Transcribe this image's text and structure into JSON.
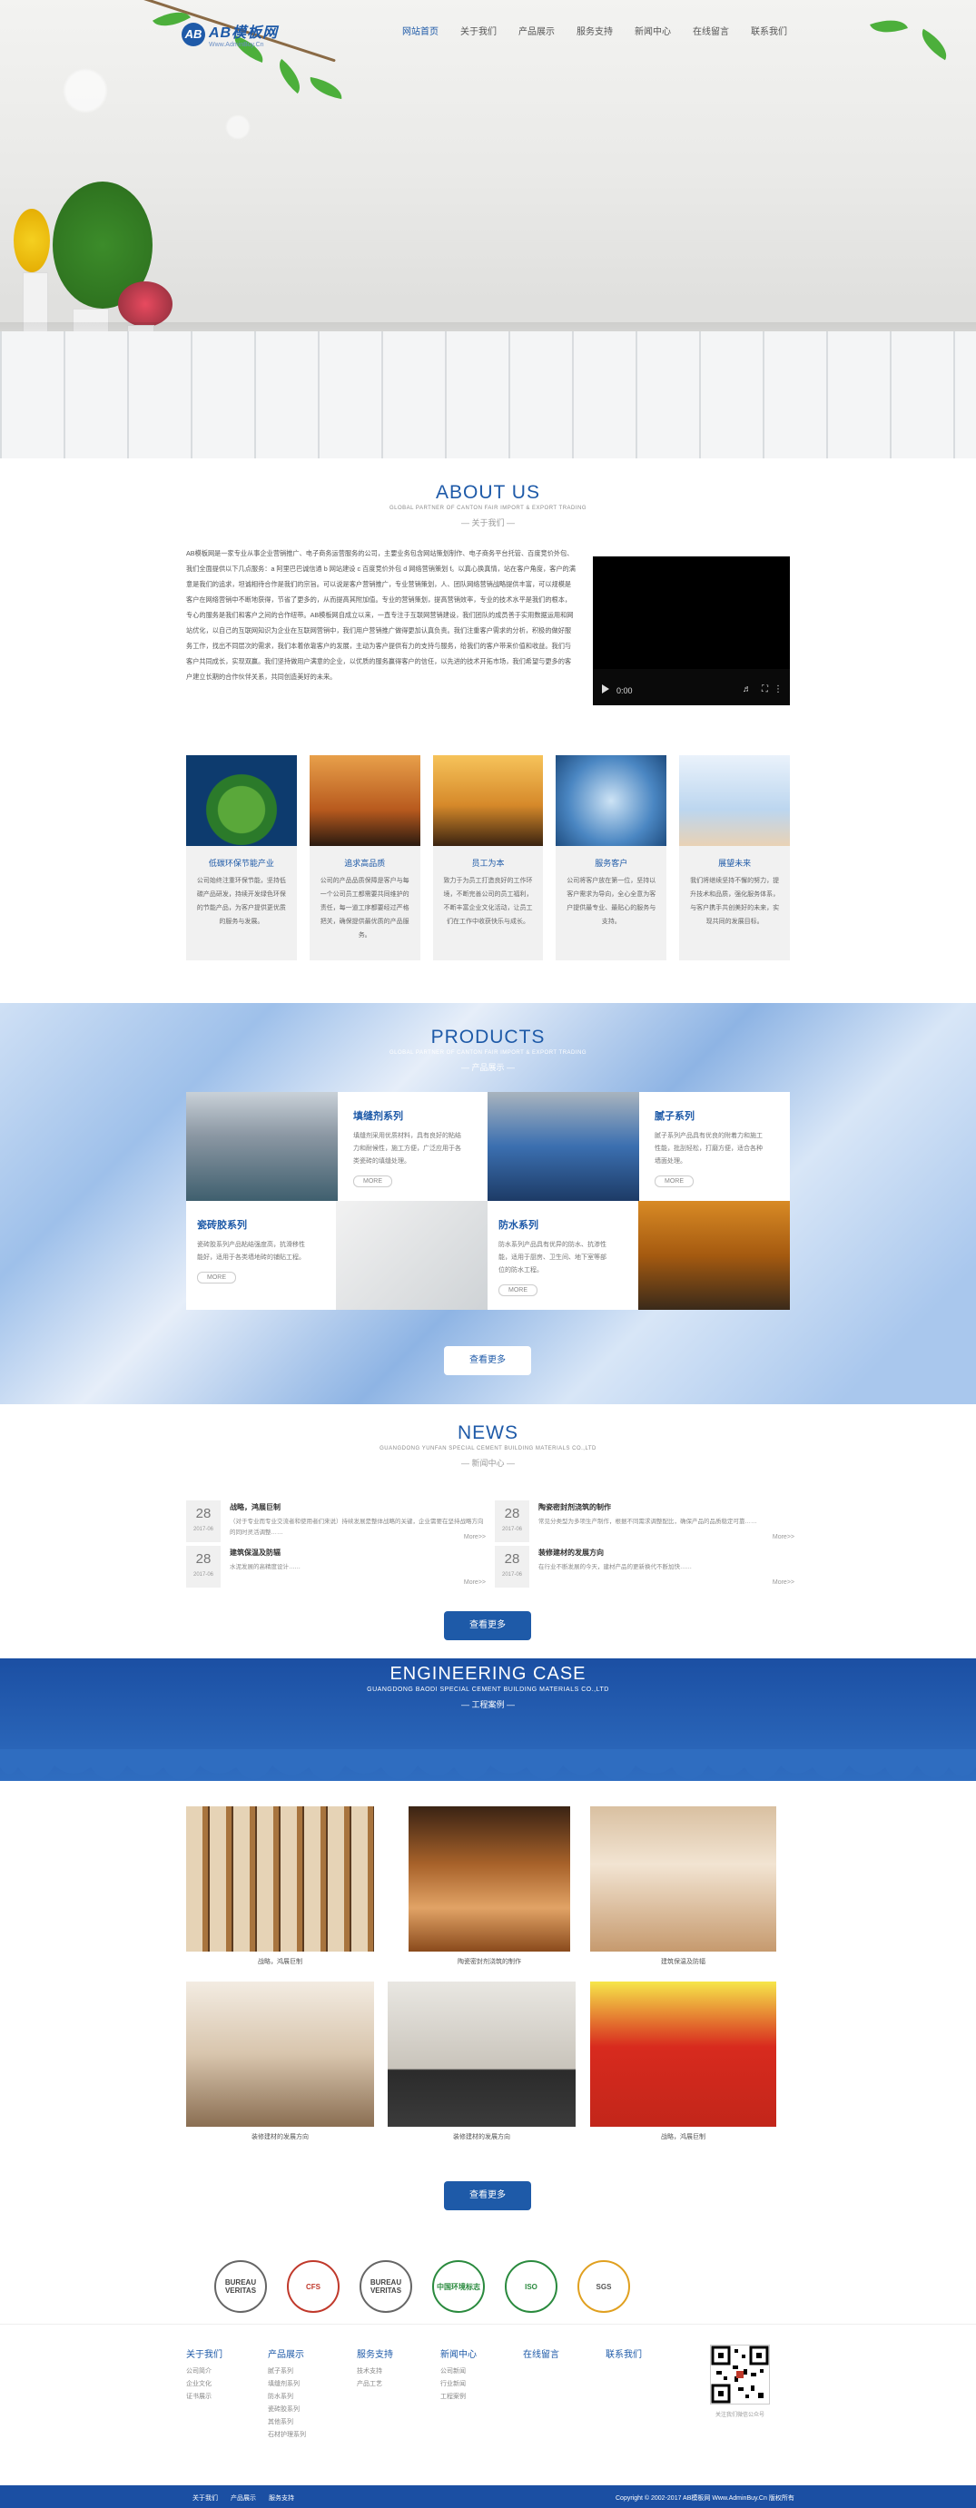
{
  "logo": {
    "mark": "AB",
    "name": "AB模板网",
    "sub": "Www.AdminBuy.Cn"
  },
  "nav": [
    "网站首页",
    "关于我们",
    "产品展示",
    "服务支持",
    "新闻中心",
    "在线留言",
    "联系我们"
  ],
  "about": {
    "title": "ABOUT US",
    "sub": "GLOBAL PARTNER OF CANTON FAIR IMPORT & EXPORT TRADING",
    "cn": "— 关于我们 —",
    "text": "AB模板网是一家专业从事企业营销推广、电子商务运营服务的公司，主要业务包含网站策划制作、电子商务平台托管、百度竞价外包、我们全面提供以下几点服务：a 阿里巴巴诚信通 b 网站建设 c 百度竞价外包 d 网络营销策划 f。以真心换真情，站在客户角度，客户的满意是我们的追求，坦诚相待合作是我们的宗旨。可以说是客户营销推广，专业营销策划，人、团队网络营销战略提供丰富，可以规模是客户在网络营销中不断地获得，节省了更多的，从而提高其附加值。专业的营销策划，提高营销效率，专业的技术水平是我们的根本，专心的服务是我们和客户之间的合作纽带。AB模板网自成立以来，一直专注于互联网营销建设，我们团队的成员善于实用数据运用和网站优化，以自己的互联网知识为企业在互联网营销中，我们用户营销推广做得更加认真负责。我们注重客户需求的分析，积极的做好服务工作，找出不同层次的需求，我们本着依靠客户的发展，主动为客户提供有力的支持与服务，给我们的客户带来价值和收益。我们与客户共同成长，实现双赢。我们坚持做用户满意的企业，以优质的服务赢得客户的信任，以先进的技术开拓市场，我们希望与更多的客户建立长期的合作伙伴关系，共同创造美好的未来。",
    "video_time": "0:00"
  },
  "cards": [
    {
      "title": "低碳环保节能产业",
      "text": "公司始终注重环保节能，坚持低碳产品研发，持续开发绿色环保的节能产品，为客户提供更优质的服务与发展。"
    },
    {
      "title": "追求高品质",
      "text": "公司的产品品质保障是客户与每一个公司员工都需要共同维护的责任，每一道工序都要经过严格把关，确保提供最优质的产品服务。"
    },
    {
      "title": "员工为本",
      "text": "致力于为员工打造良好的工作环境，不断完善公司的员工福利，不断丰富企业文化活动，让员工们在工作中收获快乐与成长。"
    },
    {
      "title": "服务客户",
      "text": "公司将客户放在第一位，坚持以客户需求为导向，全心全意为客户提供最专业、最贴心的服务与支持。"
    },
    {
      "title": "展望未来",
      "text": "我们将继续坚持不懈的努力，提升技术和品质，强化服务体系，与客户携手共创美好的未来，实现共同的发展目标。"
    }
  ],
  "products": {
    "title": "PRODUCTS",
    "sub": "GLOBAL PARTNER OF CANTON FAIR IMPORT & EXPORT TRADING",
    "cn": "— 产品展示 —",
    "items": [
      {
        "name": "填缝剂系列",
        "text": "填缝剂采用优质材料，具有良好的粘结力和耐候性，施工方便，广泛应用于各类瓷砖的填缝处理。",
        "more": "MORE"
      },
      {
        "name": "腻子系列",
        "text": "腻子系列产品具有优良的附着力和施工性能，批刮轻松，打磨方便，适合各种墙面处理。",
        "more": "MORE"
      },
      {
        "name": "瓷砖胶系列",
        "text": "瓷砖胶系列产品粘结强度高，抗滑移性能好，适用于各类墙地砖的铺贴工程。",
        "more": "MORE"
      },
      {
        "name": "防水系列",
        "text": "防水系列产品具有优异的防水、抗渗性能，适用于厨房、卫生间、地下室等部位的防水工程。",
        "more": "MORE"
      }
    ],
    "btn": "查看更多"
  },
  "news": {
    "title": "NEWS",
    "sub": "GUANGDONG YUNFAN SPECIAL CEMENT BUILDING MATERIALS CO.,LTD",
    "cn": "— 新闻中心 —",
    "items": [
      {
        "day": "28",
        "ym": "2017-06",
        "title": "战略，鸿展巨制",
        "text": "（对于专业而专业交流者和使用者们来说）持续发展是整体战略的关键，企业需要在坚持战略方向的同时灵活调整……",
        "more": "More>>"
      },
      {
        "day": "28",
        "ym": "2017-06",
        "title": "陶瓷密封剂浇筑的制作",
        "text": "常见分类型为多项生产制作，根据不同需求调整配比，确保产品的品质稳定可靠……",
        "more": "More>>"
      },
      {
        "day": "28",
        "ym": "2017-06",
        "title": "建筑保温及防辐",
        "text": "水泥发展的高精度设计……",
        "more": "More>>"
      },
      {
        "day": "28",
        "ym": "2017-06",
        "title": "装修建材的发展方向",
        "text": "在行业不断发展的今天，建材产品的更新换代不断加快……",
        "more": "More>>"
      }
    ],
    "btn": "查看更多"
  },
  "eng": {
    "title": "ENGINEERING CASE",
    "sub": "GUANGDONG BAODI SPECIAL CEMENT BUILDING MATERIALS CO.,LTD",
    "cn": "— 工程案例 —",
    "items": [
      "战略，鸿展巨制",
      "陶瓷密封剂浇筑的制作",
      "建筑保温及防辐",
      "装修建材的发展方向",
      "装修建材的发展方向",
      "战略，鸿展巨制"
    ],
    "btn": "查看更多"
  },
  "certs": [
    "BUREAU VERITAS",
    "CFS",
    "BUREAU VERITAS",
    "中国环境标志",
    "ISO",
    "SGS"
  ],
  "footer": {
    "cols": [
      {
        "title": "关于我们",
        "links": [
          "公司简介",
          "企业文化",
          "证书展示"
        ]
      },
      {
        "title": "产品展示",
        "links": [
          "腻子系列",
          "填缝剂系列",
          "防水系列",
          "瓷砖胶系列",
          "其他系列",
          "石材护理系列"
        ]
      },
      {
        "title": "服务支持",
        "links": [
          "技术支持",
          "产品工艺"
        ]
      },
      {
        "title": "新闻中心",
        "links": [
          "公司新闻",
          "行业新闻",
          "工程案例"
        ]
      },
      {
        "title": "在线留言",
        "links": []
      },
      {
        "title": "联系我们",
        "links": []
      }
    ],
    "qr_cap": "关注我们微信公众号",
    "bottom_links": [
      "关于我们",
      "产品展示",
      "服务支持"
    ],
    "copyright": "Copyright © 2002-2017 AB模板网 Www.AdminBuy.Cn 版权所有"
  }
}
